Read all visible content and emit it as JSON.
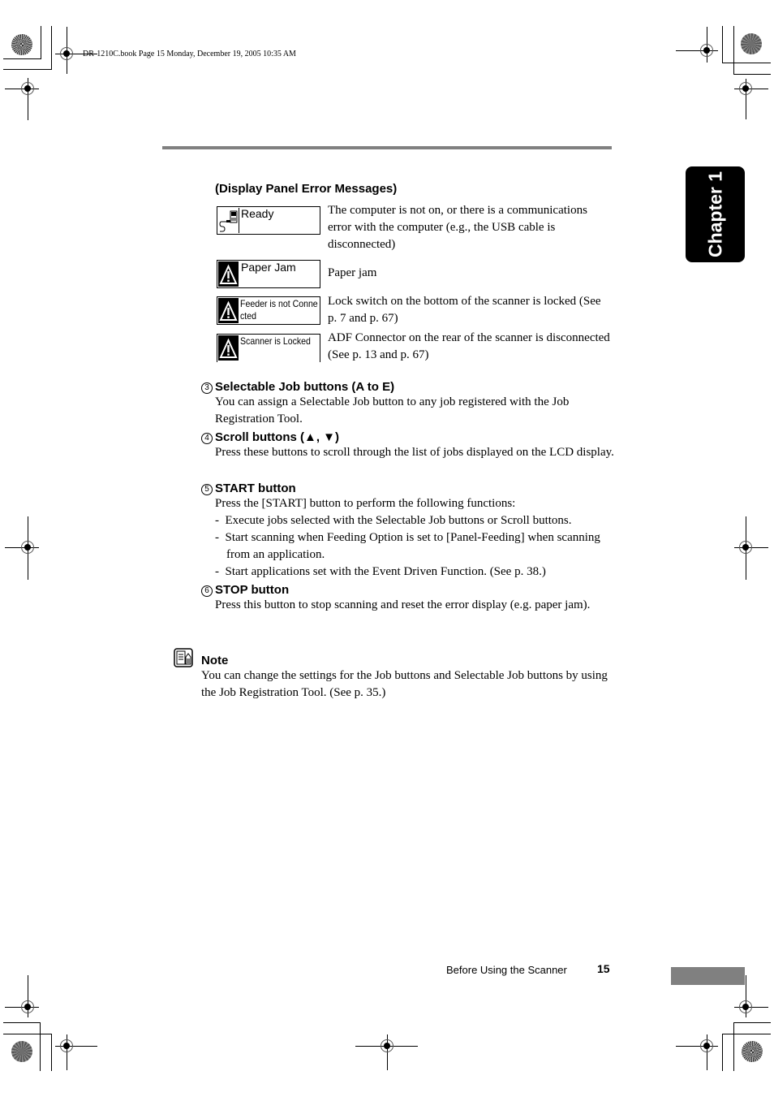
{
  "print_header": "DR-1210C.book  Page 15  Monday, December 19, 2005  10:35 AM",
  "chapter_tab": "Chapter 1",
  "display_panel": {
    "title": "(Display Panel Error Messages)",
    "rows": [
      {
        "lcd_text": "Ready",
        "icon": "usb-cable-icon",
        "description": "The computer is not on, or there is a communications error with the computer (e.g., the USB cable is disconnected)"
      },
      {
        "lcd_text": "Paper Jam",
        "icon": "warning-icon",
        "description": "Paper jam"
      },
      {
        "lcd_text": "Feeder is not Conne cted",
        "icon": "warning-icon",
        "description": "Lock switch on the bottom of the scanner is locked (See p. 7 and p. 67)"
      },
      {
        "lcd_text": "Scanner is Locked",
        "icon": "warning-icon",
        "description": "ADF Connector on the rear of the scanner is disconnected (See p. 13 and p. 67)"
      }
    ]
  },
  "sections": [
    {
      "number": "3",
      "title": "Selectable Job buttons (A to E)",
      "body": "You can assign a Selectable Job button to any job registered with the Job Registration Tool."
    },
    {
      "number": "4",
      "title": "Scroll buttons (▲, ▼)",
      "body": "Press these buttons to scroll through the list of jobs displayed on the LCD display."
    },
    {
      "number": "5",
      "title": "START button",
      "body": "Press the [START] button to perform the following functions:",
      "bullets": [
        "Execute jobs selected with the Selectable Job buttons or Scroll buttons.",
        "Start scanning when Feeding Option is set to [Panel-Feeding] when scanning from an application.",
        "Start applications set with the Event Driven Function. (See p. 38.)"
      ]
    },
    {
      "number": "6",
      "title": "STOP button",
      "body": "Press this button to stop scanning and reset the error display (e.g. paper jam)."
    }
  ],
  "note": {
    "title": "Note",
    "body": "You can change the settings for the Job buttons and Selectable Job buttons by using the Job Registration Tool. (See p. 35.)"
  },
  "footer": {
    "section_name": "Before Using the Scanner",
    "page_number": "15"
  }
}
